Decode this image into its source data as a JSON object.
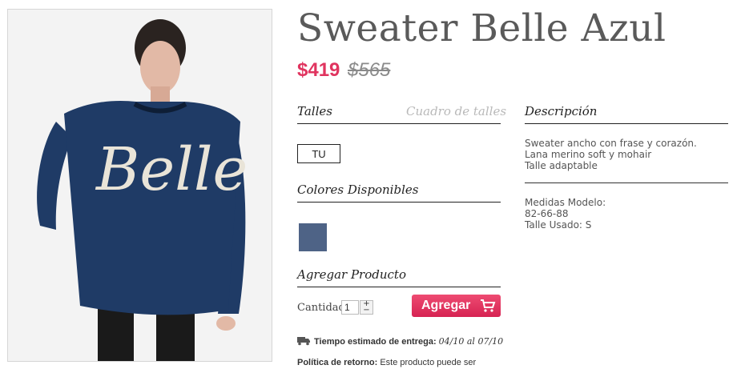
{
  "product": {
    "title": "Sweater Belle Azul",
    "price": "$419",
    "old_price": "$565",
    "photo_text": "Belle"
  },
  "sizes": {
    "heading": "Talles",
    "chart_link": "Cuadro de talles",
    "options": [
      "TU"
    ]
  },
  "colors": {
    "heading": "Colores Disponibles",
    "swatches": [
      "#4e6386"
    ]
  },
  "add": {
    "heading": "Agregar Producto",
    "quantity_label": "Cantidad",
    "quantity_value": "1",
    "button_label": "Agregar"
  },
  "shipping": {
    "label": "Tiempo estimado de entrega:",
    "value": "04/10 al 07/10"
  },
  "returns": {
    "label": "Política de retorno:",
    "text": "Este producto puede ser"
  },
  "description": {
    "heading": "Descripción",
    "lines": [
      "Sweater ancho con frase y corazón.",
      "Lana merino soft y mohair",
      "Talle adaptable"
    ],
    "model_lines": [
      "Medidas Modelo:",
      "82-66-88",
      "Talle Usado: S"
    ]
  },
  "colors_theme": {
    "accent": "#e0345f",
    "title": "#5a5a5a"
  }
}
